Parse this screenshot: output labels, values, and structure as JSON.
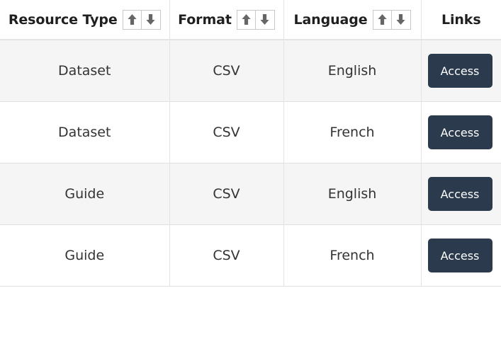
{
  "table": {
    "columns": [
      {
        "label": "Resource Type",
        "sortable": true,
        "align": "center"
      },
      {
        "label": "Format",
        "sortable": true,
        "align": "center"
      },
      {
        "label": "Language",
        "sortable": true,
        "align": "center"
      },
      {
        "label": "Links",
        "sortable": false,
        "align": "center"
      }
    ],
    "sort_icons": {
      "ascending": "sort-ascending-arrow-icon",
      "descending": "sort-descending-arrow-icon"
    },
    "rows": [
      {
        "resource_type": "Dataset",
        "format": "CSV",
        "language": "English",
        "link_label": "Access"
      },
      {
        "resource_type": "Dataset",
        "format": "CSV",
        "language": "French",
        "link_label": "Access"
      },
      {
        "resource_type": "Guide",
        "format": "CSV",
        "language": "English",
        "link_label": "Access"
      },
      {
        "resource_type": "Guide",
        "format": "CSV",
        "language": "French",
        "link_label": "Access"
      }
    ]
  },
  "colors": {
    "button_background": "#2b3a4d",
    "button_text": "#ffffff",
    "row_stripe": "#f5f5f6",
    "row_plain": "#ffffff",
    "border": "#e4e4e6",
    "header_text": "#1f1f1f",
    "cell_text": "#333333",
    "sort_arrow": "#666666"
  }
}
